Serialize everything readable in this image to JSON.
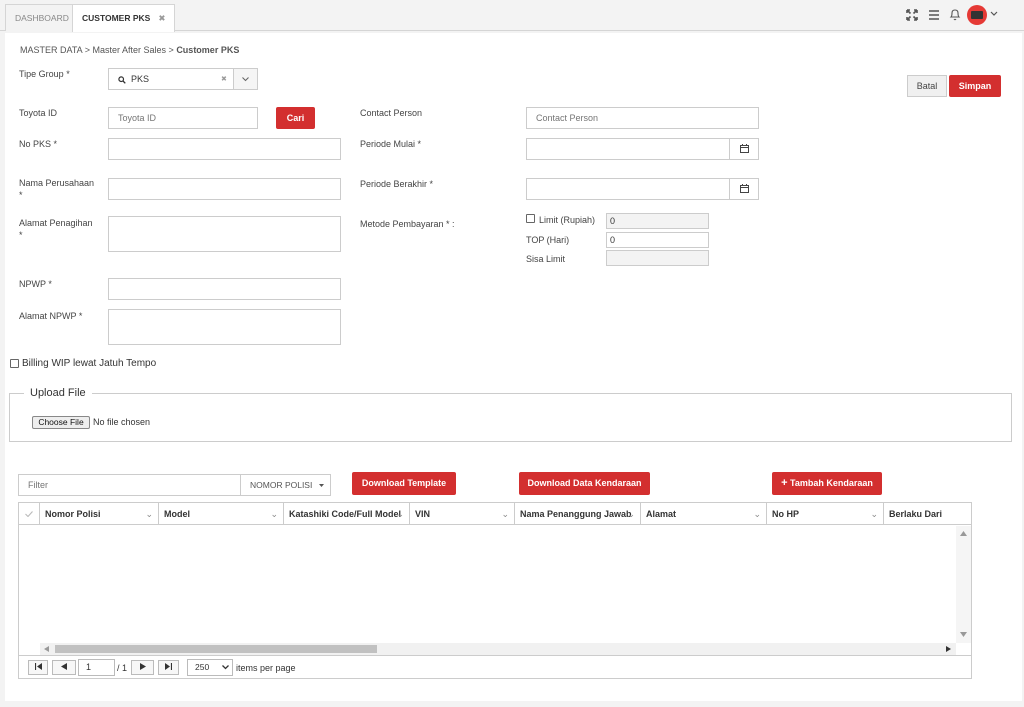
{
  "tabs": [
    {
      "label": "DASHBOARD"
    },
    {
      "label": "CUSTOMER PKS",
      "close": "✖"
    }
  ],
  "header_icons": [
    "expand-icon",
    "menu-icon",
    "bell-icon",
    "avatar",
    "chevron-down-icon"
  ],
  "breadcrumb": {
    "root": "MASTER DATA",
    "sep": ">",
    "middle": "Master After Sales",
    "current": "Customer PKS"
  },
  "actions": {
    "cancel": "Batal",
    "save": "Simpan"
  },
  "form": {
    "tipe_group": {
      "label": "Tipe Group *",
      "value": "PKS",
      "clear": "✖"
    },
    "toyota_id": {
      "label": "Toyota ID",
      "placeholder": "Toyota ID",
      "search_button": "Cari"
    },
    "contact_person": {
      "label": "Contact Person",
      "placeholder": "Contact Person"
    },
    "no_pks": {
      "label": "No PKS *"
    },
    "periode_mulai": {
      "label": "Periode Mulai *"
    },
    "nama_perusahaan": {
      "label1": "Nama Perusahaan",
      "label2": "*"
    },
    "periode_berakhir": {
      "label": "Periode Berakhir *"
    },
    "alamat_penagihan": {
      "label1": "Alamat Penagihan",
      "label2": "*"
    },
    "metode_pembayaran": {
      "label": "Metode Pembayaran * :",
      "limit_label": "Limit (Rupiah)",
      "limit_value": "0",
      "top_label": "TOP (Hari)",
      "top_value": "0",
      "sisa_label": "Sisa Limit",
      "sisa_value": ""
    },
    "npwp": {
      "label": "NPWP *"
    },
    "alamat_npwp": {
      "label": "Alamat NPWP *"
    },
    "billing_wip": {
      "label": "Billing WIP lewat Jatuh Tempo"
    }
  },
  "upload": {
    "legend": "Upload File",
    "choose_button": "Choose File",
    "status": "No file chosen"
  },
  "grid_toolbar": {
    "filter_placeholder": "Filter",
    "filter_field": "NOMOR POLISI",
    "download_template": "Download Template",
    "download_data": "Download Data Kendaraan",
    "add_button": "Tambah Kendaraan"
  },
  "grid": {
    "columns": [
      "Nomor Polisi",
      "Model",
      "Katashiki Code/Full Model",
      "VIN",
      "Nama Penanggung Jawab",
      "Alamat",
      "No HP",
      "Berlaku Dari"
    ],
    "rows": []
  },
  "pager": {
    "page": "1",
    "of": "/ 1",
    "page_size": "250",
    "page_size_label": "items per page"
  }
}
